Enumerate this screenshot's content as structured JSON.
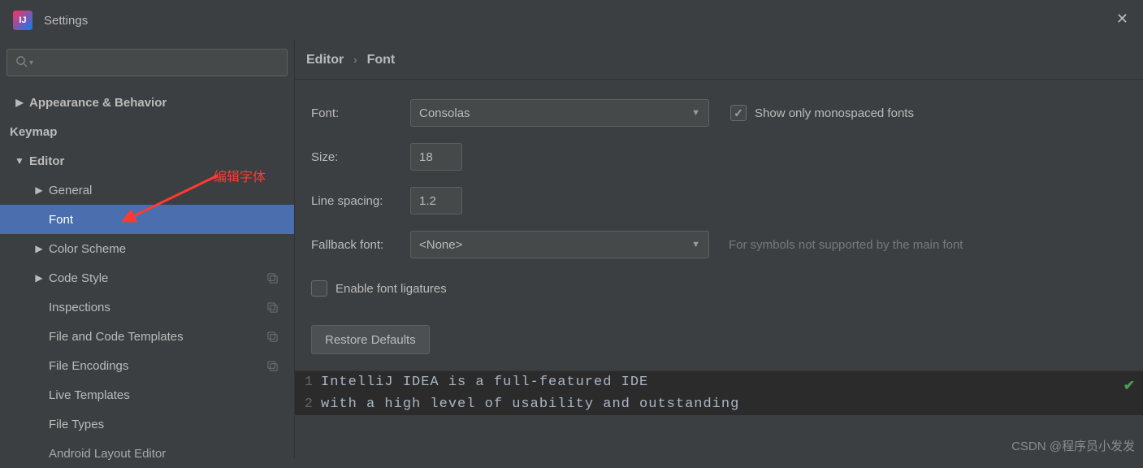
{
  "window": {
    "title": "Settings"
  },
  "search": {
    "placeholder": ""
  },
  "sidebar": {
    "items": [
      {
        "label": "Appearance & Behavior",
        "bold": true,
        "arrow": "right",
        "indent": 0
      },
      {
        "label": "Keymap",
        "bold": true,
        "arrow": "",
        "indent": 0
      },
      {
        "label": "Editor",
        "bold": true,
        "arrow": "down",
        "indent": 0
      },
      {
        "label": "General",
        "bold": false,
        "arrow": "right",
        "indent": 1
      },
      {
        "label": "Font",
        "bold": false,
        "arrow": "",
        "indent": 1,
        "selected": true
      },
      {
        "label": "Color Scheme",
        "bold": false,
        "arrow": "right",
        "indent": 1
      },
      {
        "label": "Code Style",
        "bold": false,
        "arrow": "right",
        "indent": 1,
        "badge": true
      },
      {
        "label": "Inspections",
        "bold": false,
        "arrow": "",
        "indent": 1,
        "badge": true
      },
      {
        "label": "File and Code Templates",
        "bold": false,
        "arrow": "",
        "indent": 1,
        "badge": true
      },
      {
        "label": "File Encodings",
        "bold": false,
        "arrow": "",
        "indent": 1,
        "badge": true
      },
      {
        "label": "Live Templates",
        "bold": false,
        "arrow": "",
        "indent": 1
      },
      {
        "label": "File Types",
        "bold": false,
        "arrow": "",
        "indent": 1
      },
      {
        "label": "Android Layout Editor",
        "bold": false,
        "arrow": "",
        "indent": 1,
        "cut": true
      }
    ]
  },
  "breadcrumb": {
    "a": "Editor",
    "b": "Font"
  },
  "form": {
    "font_label": "Font:",
    "font_value": "Consolas",
    "mono_label": "Show only monospaced fonts",
    "mono_checked": true,
    "size_label": "Size:",
    "size_value": "18",
    "ls_label": "Line spacing:",
    "ls_value": "1.2",
    "fb_label": "Fallback font:",
    "fb_value": "<None>",
    "fb_hint": "For symbols not supported by the main font",
    "lig_label": "Enable font ligatures",
    "lig_checked": false,
    "restore": "Restore Defaults"
  },
  "preview": {
    "lines": [
      {
        "n": "1",
        "t": "IntelliJ IDEA is a full-featured IDE"
      },
      {
        "n": "2",
        "t": "with a high level of usability and outstanding"
      }
    ]
  },
  "annotation": "编辑字体",
  "watermark": "CSDN @程序员小发发"
}
